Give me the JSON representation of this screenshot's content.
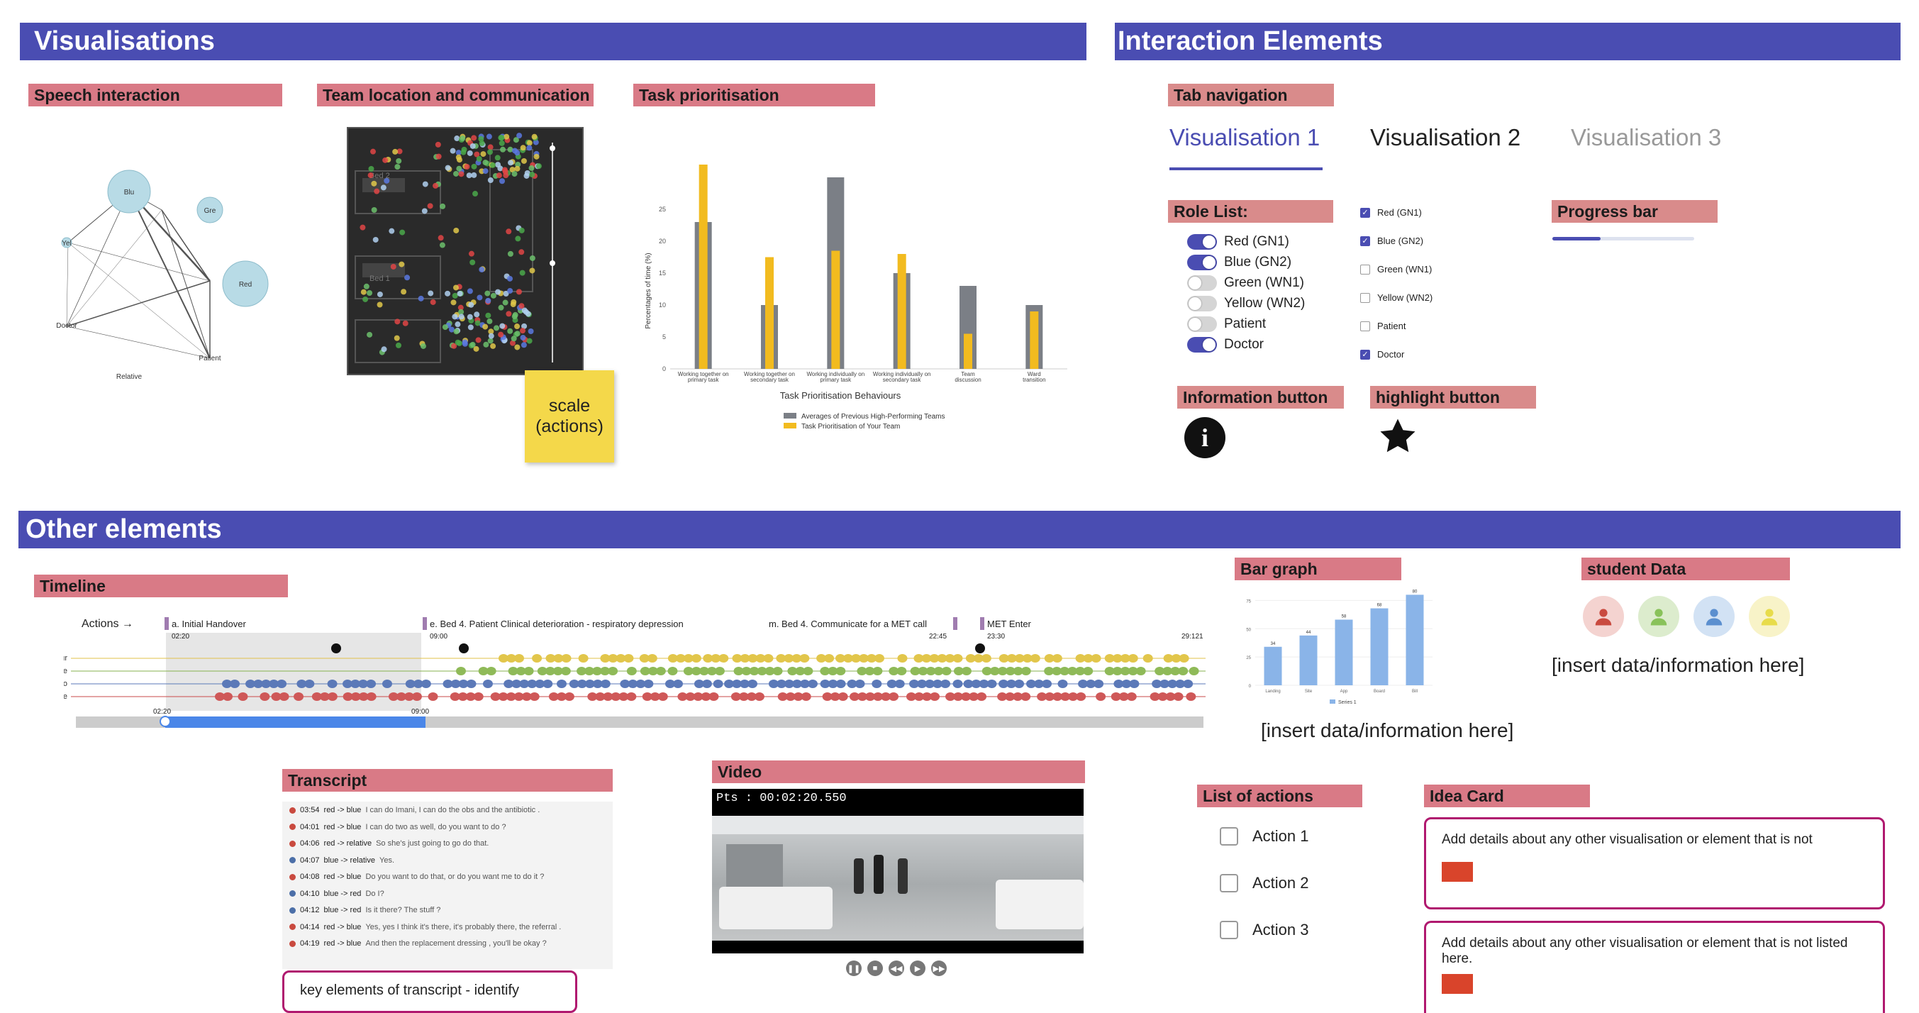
{
  "sections": {
    "visualisations": "Visualisations",
    "interaction": "Interaction Elements",
    "other": "Other elements"
  },
  "panels": {
    "speech": "Speech interaction",
    "team": "Team location and communication",
    "task": "Task prioritisation",
    "tabnav": "Tab navigation",
    "rolelist": "Role List:",
    "progress": "Progress bar",
    "infobtn": "Information button",
    "highlight": "highlight button",
    "timeline": "Timeline",
    "bargraph": "Bar graph",
    "student": "student Data",
    "transcript": "Transcript",
    "video": "Video",
    "actions": "List of actions",
    "idea": "Idea Card"
  },
  "speech_graph": {
    "nodes": [
      "Blu",
      "Gre",
      "Red",
      "Yel",
      "Doctor",
      "Patient",
      "Relative"
    ]
  },
  "sticky_note": "scale\n(actions)",
  "chart_data": [
    {
      "type": "bar",
      "title": "",
      "xlabel": "Task Prioritisation Behaviours",
      "ylabel": "Percentages of time (%)",
      "ylim": [
        0,
        25
      ],
      "yticks": [
        0,
        5,
        10,
        15,
        20,
        25
      ],
      "categories": [
        "Working together on primary task",
        "Working together on secondary task",
        "Working individually on primary task",
        "Working individually on secondary task",
        "Team discussion",
        "Ward transition"
      ],
      "series": [
        {
          "name": "Averages of Previous High-Performing Teams",
          "color": "#7b7f86",
          "values": [
            23,
            10,
            30,
            15,
            13,
            10
          ]
        },
        {
          "name": "Task Prioritisation of Your Team",
          "color": "#f2bb1f",
          "values": [
            32,
            17.5,
            18.5,
            18,
            5.5,
            9
          ]
        }
      ]
    },
    {
      "type": "bar",
      "title": "",
      "categories": [
        "Landing",
        "Site",
        "App",
        "Board",
        "Bill"
      ],
      "ylim": [
        0,
        75
      ],
      "yticks": [
        0,
        25,
        50,
        75
      ],
      "series": [
        {
          "name": "Series 1",
          "color": "#8ab4e8",
          "values": [
            34,
            44,
            58,
            68,
            80
          ]
        }
      ]
    }
  ],
  "tabs": [
    {
      "label": "Visualisation 1",
      "state": "active"
    },
    {
      "label": "Visualisation 2",
      "state": "normal"
    },
    {
      "label": "Visualisation 3",
      "state": "disabled"
    }
  ],
  "roles_toggle": [
    {
      "label": "Red (GN1)",
      "on": true
    },
    {
      "label": "Blue (GN2)",
      "on": true
    },
    {
      "label": "Green (WN1)",
      "on": false
    },
    {
      "label": "Yellow (WN2)",
      "on": false
    },
    {
      "label": "Patient",
      "on": false
    },
    {
      "label": "Doctor",
      "on": true
    }
  ],
  "roles_checkbox": [
    {
      "label": "Red (GN1)",
      "on": true
    },
    {
      "label": "Blue (GN2)",
      "on": true
    },
    {
      "label": "Green (WN1)",
      "on": false
    },
    {
      "label": "Yellow (WN2)",
      "on": false
    },
    {
      "label": "Patient",
      "on": false
    },
    {
      "label": "Doctor",
      "on": true
    }
  ],
  "progress": {
    "value": 0.34
  },
  "timeline": {
    "axis_label": "Actions →",
    "lanes": [
      "four",
      "three",
      "two",
      "one"
    ],
    "events": [
      {
        "label": "a. Initial Handover",
        "time": "02:20"
      },
      {
        "label": "e. Bed 4. Patient Clinical deterioration - respiratory depression",
        "time": "09:00"
      },
      {
        "label": "m. Bed 4. Communicate for a MET call",
        "time": "22:45"
      },
      {
        "label": "MET Enter",
        "time": "23:30"
      }
    ],
    "end_time": "29:121",
    "scrub_start": "02:20",
    "scrub_end": "09:00"
  },
  "placeholder_text": "[insert data/information here]",
  "students": [
    {
      "color": "#f4d3d0",
      "icon": "#c94a3f"
    },
    {
      "color": "#dceccd",
      "icon": "#89c25a"
    },
    {
      "color": "#d2e2f4",
      "icon": "#5b8fcf"
    },
    {
      "color": "#f8f3c8",
      "icon": "#e8dc4b"
    }
  ],
  "transcript": {
    "rows": [
      {
        "color": "#c94a3f",
        "time": "03:54",
        "route": "red -> blue",
        "text": "I can do Imani, I can do the obs and the antibiotic ."
      },
      {
        "color": "#c94a3f",
        "time": "04:01",
        "route": "red -> blue",
        "text": "I can do two as well, do you want to do ?"
      },
      {
        "color": "#c94a3f",
        "time": "04:06",
        "route": "red -> relative",
        "text": "So she's just going to go do that."
      },
      {
        "color": "#4c6fa8",
        "time": "04:07",
        "route": "blue -> relative",
        "text": "Yes."
      },
      {
        "color": "#c94a3f",
        "time": "04:08",
        "route": "red -> blue",
        "text": "Do you want to do that, or do you want me to do it ?"
      },
      {
        "color": "#4c6fa8",
        "time": "04:10",
        "route": "blue -> red",
        "text": "Do I?"
      },
      {
        "color": "#4c6fa8",
        "time": "04:12",
        "route": "blue -> red",
        "text": "Is it there? The stuff ?"
      },
      {
        "color": "#c94a3f",
        "time": "04:14",
        "route": "red -> blue",
        "text": "Yes, yes I think it's there, it's probably there, the referral ."
      },
      {
        "color": "#c94a3f",
        "time": "04:19",
        "route": "red -> blue",
        "text": "And then the replacement dressing , you'll be okay ?"
      }
    ],
    "note": "key elements of transcript - identify"
  },
  "video": {
    "timestamp": "Pts : 00:02:20.550"
  },
  "action_items": [
    "Action 1",
    "Action 2",
    "Action 3"
  ],
  "idea_cards": [
    "Add details about any other visualisation or element that is not",
    "Add details about any other visualisation or element that is not listed here."
  ]
}
